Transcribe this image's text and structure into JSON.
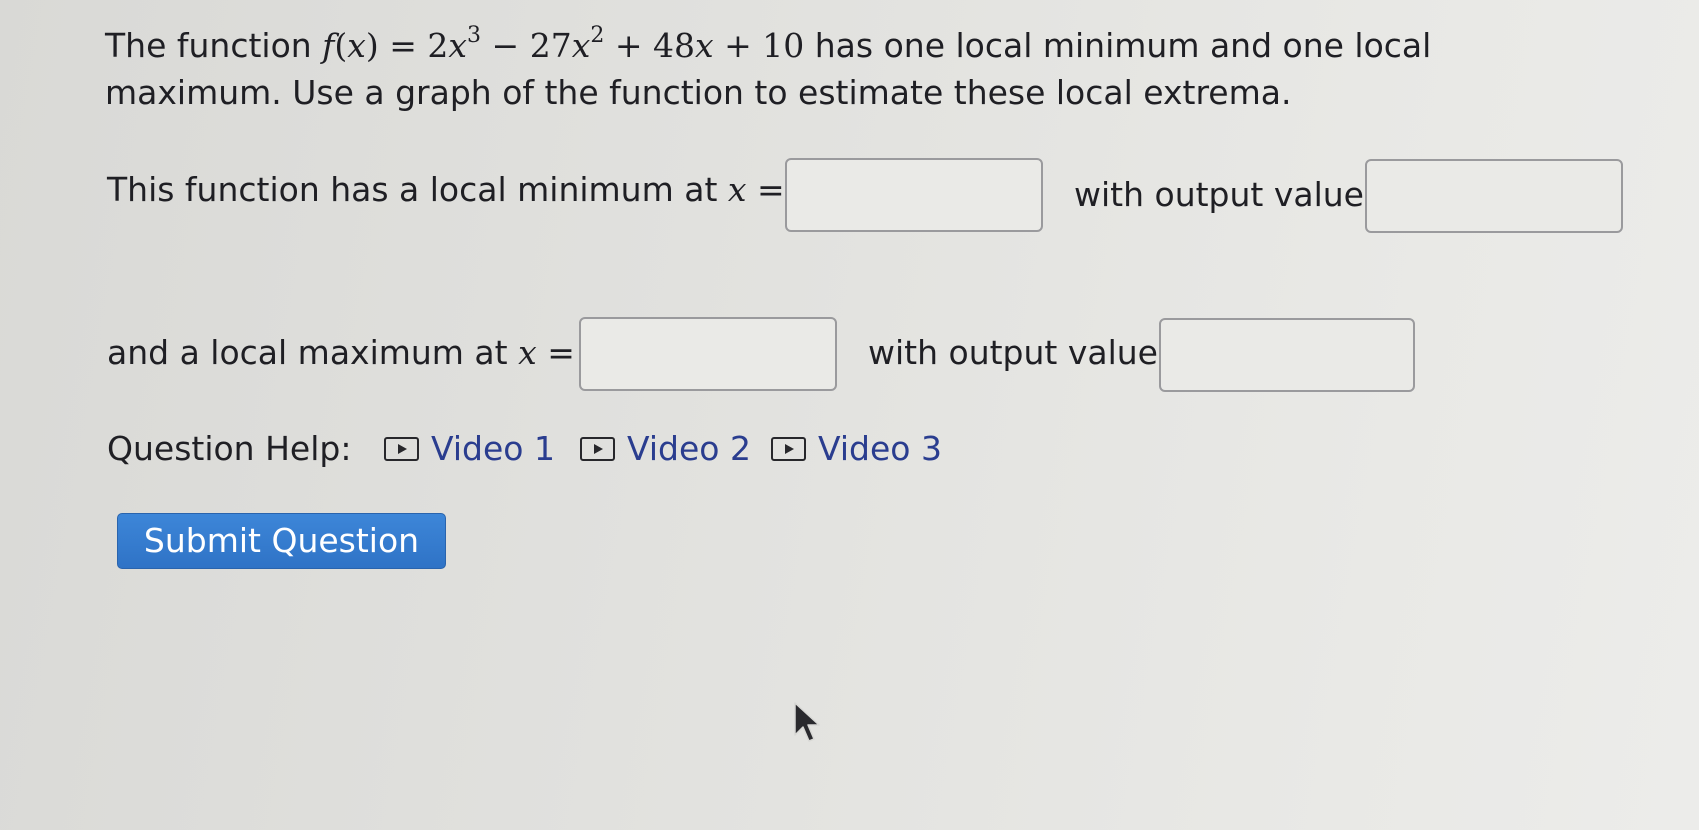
{
  "question": {
    "intro_text": "The function",
    "function_name": "f",
    "function_var": "x",
    "eq": "=",
    "t_coef1": "2",
    "t_var": "x",
    "t_exp1": "3",
    "t_minus": "−",
    "t_coef2": "27",
    "t_exp2": "2",
    "t_plus": "+",
    "t_coef3": "48",
    "t_const": "10",
    "after_function": "has one local minimum and one local",
    "line2": "maximum. Use a graph of the function to estimate these local extrema."
  },
  "minimum_row": {
    "prefix": "This function has a local minimum at",
    "var": "x",
    "equals": "=",
    "x_value": "",
    "output_label": "with output value",
    "y_value": ""
  },
  "maximum_row": {
    "prefix": "and a local maximum at",
    "var": "x",
    "equals": "=",
    "x_value": "",
    "output_label": "with output value",
    "y_value": ""
  },
  "help": {
    "label": "Question Help:",
    "videos": [
      {
        "label": "Video 1",
        "icon": "play-icon"
      },
      {
        "label": "Video 2",
        "icon": "play-icon"
      },
      {
        "label": "Video 3",
        "icon": "play-icon"
      }
    ]
  },
  "submit_label": "Submit Question",
  "colors": {
    "link": "#2a3d8f",
    "button": "#3079cd",
    "text": "#1f1f24"
  }
}
